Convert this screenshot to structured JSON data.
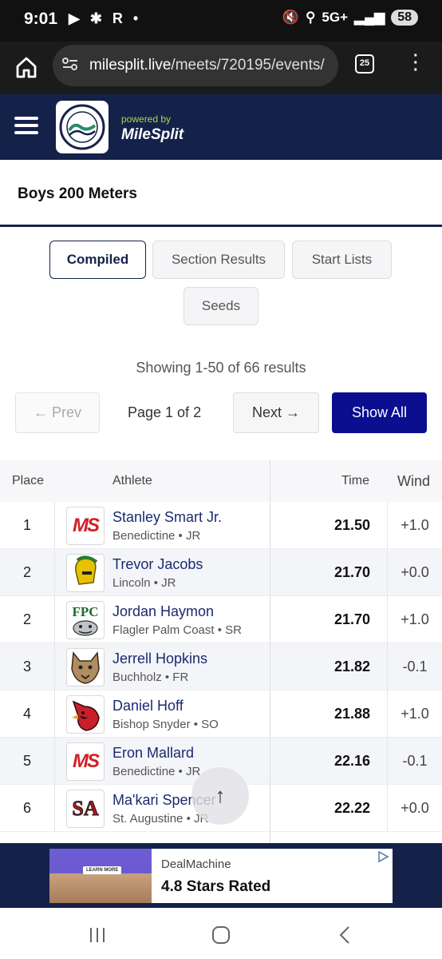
{
  "status_bar": {
    "time": "9:01",
    "left_icons": "▶ ✱ R •",
    "network": "5G+",
    "battery": "58"
  },
  "browser": {
    "url_domain": "milesplit.live",
    "url_path": "/meets/720195/events/",
    "tab_count": "25"
  },
  "site_header": {
    "logo_text": "JACKSONVILLE ATHLETIC CLUB",
    "powered_by": "powered by",
    "brand": "MileSplit"
  },
  "event": {
    "title": "Boys 200 Meters"
  },
  "tabs": [
    {
      "label": "Compiled",
      "active": true
    },
    {
      "label": "Section Results",
      "active": false
    },
    {
      "label": "Start Lists",
      "active": false
    },
    {
      "label": "Seeds",
      "active": false
    }
  ],
  "pagination": {
    "showing": "Showing 1-50 of 66 results",
    "prev": "← Prev",
    "page_info": "Page 1 of 2",
    "next": "Next →",
    "show_all": "Show All"
  },
  "table": {
    "headers": {
      "place": "Place",
      "athlete": "Athlete",
      "time": "Time",
      "wind": "Wind"
    },
    "rows": [
      {
        "place": "1",
        "name": "Stanley Smart Jr.",
        "team": "Benedictine • JR",
        "time": "21.50",
        "wind": "+1.0",
        "logo": "MS"
      },
      {
        "place": "2",
        "name": "Trevor Jacobs",
        "team": "Lincoln • JR",
        "time": "21.70",
        "wind": "+0.0",
        "logo": "trojan-icon"
      },
      {
        "place": "2",
        "name": "Jordan Haymon",
        "team": "Flagler Palm Coast • SR",
        "time": "21.70",
        "wind": "+1.0",
        "logo": "FPC"
      },
      {
        "place": "3",
        "name": "Jerrell Hopkins",
        "team": "Buchholz • FR",
        "time": "21.82",
        "wind": "-0.1",
        "logo": "bobcat-icon"
      },
      {
        "place": "4",
        "name": "Daniel Hoff",
        "team": "Bishop Snyder • SO",
        "time": "21.88",
        "wind": "+1.0",
        "logo": "cardinal-icon"
      },
      {
        "place": "5",
        "name": "Eron Mallard",
        "team": "Benedictine • JR",
        "time": "22.16",
        "wind": "-0.1",
        "logo": "MS"
      },
      {
        "place": "6",
        "name": "Ma'kari Spencer",
        "team": "St. Augustine • JR",
        "time": "22.22",
        "wind": "+0.0",
        "logo": "SA"
      }
    ]
  },
  "ad": {
    "brand": "DealMachine",
    "rating": "4.8 Stars Rated",
    "thumb_text": "LEARN MORE"
  },
  "colors": {
    "navy": "#14224a",
    "button_blue": "#0a0e8f",
    "link_navy": "#1a2a6e",
    "ms_red": "#d21f26",
    "lime": "#a8d84a"
  }
}
